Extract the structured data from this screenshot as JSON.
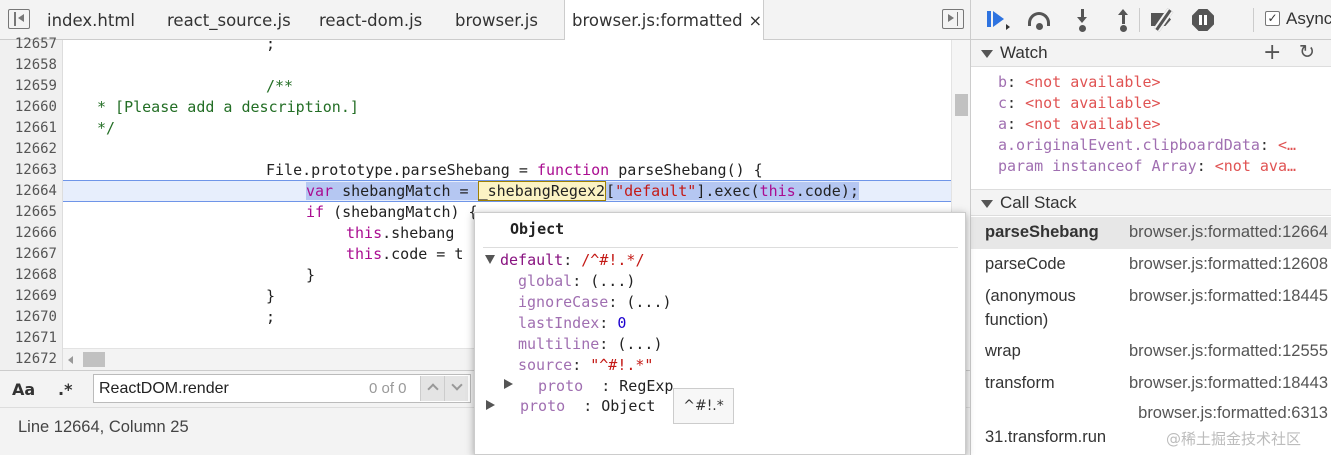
{
  "tabs": [
    {
      "label": "index.html"
    },
    {
      "label": "react_source.js"
    },
    {
      "label": "react-dom.js"
    },
    {
      "label": "browser.js"
    },
    {
      "label": "browser.js:formatted",
      "close": "×"
    }
  ],
  "editor": {
    "line_numbers": [
      "12657",
      "12658",
      "12659",
      "12660",
      "12661",
      "12662",
      "12663",
      "12664",
      "12665",
      "12666",
      "12667",
      "12668",
      "12669",
      "12670",
      "12671",
      "12672"
    ],
    "lines": {
      "l12657": ";",
      "l12659": "/**",
      "l12660": "* [Please add a description.]",
      "l12661": "*/",
      "l12663_a": "File.prototype.parseShebang = ",
      "l12663_kw": "function",
      "l12663_b": " parseShebang() {",
      "l12664_kw": "var",
      "l12664_a": " shebangMatch = ",
      "l12664_hl": "_shebangRegex2",
      "l12664_b": "[",
      "l12664_str": "\"default\"",
      "l12664_c": "].exec(",
      "l12664_kw2": "this",
      "l12664_d": ".code);",
      "l12665_kw": "if",
      "l12665_a": " (shebangMatch) {",
      "l12666_kw": "this",
      "l12666_a": ".shebang",
      "l12667_kw": "this",
      "l12667_a": ".code = t",
      "l12668": "}",
      "l12669": "}",
      "l12670": ";"
    }
  },
  "search": {
    "case_label": "Aa",
    "regex_label": ".*",
    "value": "ReactDOM.render",
    "count": "0 of 0"
  },
  "status": {
    "cursor": "Line 12664, Column 25"
  },
  "debugger": {
    "async_label": "Async",
    "async_checked": "✓"
  },
  "watch": {
    "title": "Watch",
    "add": "+",
    "refresh": "↻",
    "items": [
      {
        "name": "b",
        "value": "<not available>"
      },
      {
        "name": "c",
        "value": "<not available>"
      },
      {
        "name": "a",
        "value": "<not available>"
      },
      {
        "name": "a.originalEvent.clipboardData",
        "value": "<…"
      },
      {
        "name": "param instanceof Array",
        "value": "<not ava…"
      }
    ]
  },
  "call_stack": {
    "title": "Call Stack",
    "frames": [
      {
        "fn": "parseShebang",
        "loc": "browser.js:formatted:12664"
      },
      {
        "fn": "parseCode",
        "loc": "browser.js:formatted:12608"
      },
      {
        "fn": "(anonymous",
        "fn2": "function)",
        "loc": "browser.js:formatted:18445"
      },
      {
        "fn": "wrap",
        "loc": "browser.js:formatted:12555"
      },
      {
        "fn": "transform",
        "loc": "browser.js:formatted:18443"
      },
      {
        "fn": "31.transform.run",
        "loc": "browser.js:formatted:6313"
      }
    ]
  },
  "popover": {
    "title": "Object",
    "default_key": "default",
    "default_val": "/^#!.*/",
    "props": [
      {
        "key": "global",
        "val": "(...)"
      },
      {
        "key": "ignoreCase",
        "val": "(...)"
      },
      {
        "key": "lastIndex",
        "val": "0"
      },
      {
        "key": "multiline",
        "val": "(...)"
      },
      {
        "key": "source",
        "val": "\"^#!.*\""
      }
    ],
    "proto_inner_key": "proto",
    "proto_inner_val": "RegExp",
    "proto_outer_key": "proto",
    "proto_outer_val": "Object",
    "tooltip": "^#!.*"
  },
  "watermark": "@稀土掘金技术社区"
}
